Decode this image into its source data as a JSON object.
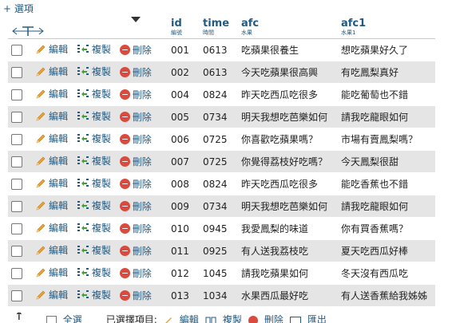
{
  "options_link": "+ 選項",
  "columns": {
    "id": {
      "label": "id",
      "comment": "編號"
    },
    "time": {
      "label": "time",
      "comment": "時間"
    },
    "afc": {
      "label": "afc",
      "comment": "水果"
    },
    "afc1": {
      "label": "afc1",
      "comment": "水果1"
    }
  },
  "actions": {
    "edit": "編輯",
    "copy": "複製",
    "delete": "刪除"
  },
  "rows": [
    {
      "id": "001",
      "time": "0613",
      "afc": "吃蘋果很養生",
      "afc1": "想吃蘋果好久了"
    },
    {
      "id": "002",
      "time": "0613",
      "afc": "今天吃蘋果很高興",
      "afc1": "有吃鳳梨真好"
    },
    {
      "id": "004",
      "time": "0824",
      "afc": "昨天吃西瓜吃很多",
      "afc1": "能吃葡萄也不錯"
    },
    {
      "id": "005",
      "time": "0734",
      "afc": "明天我想吃芭樂如何",
      "afc1": "請我吃龍眼如何"
    },
    {
      "id": "006",
      "time": "0725",
      "afc": "你喜歡吃蘋果嗎？",
      "afc1": "市場有賣鳳梨嗎？"
    },
    {
      "id": "007",
      "time": "0725",
      "afc": "你覺得荔枝好吃嗎？",
      "afc1": "今天鳳梨很甜"
    },
    {
      "id": "008",
      "time": "0824",
      "afc": "昨天吃西瓜吃很多",
      "afc1": "能吃香蕉也不錯"
    },
    {
      "id": "009",
      "time": "0734",
      "afc": "明天我想吃芭樂如何",
      "afc1": "請我吃龍眼如何"
    },
    {
      "id": "010",
      "time": "0945",
      "afc": "我愛鳳梨的味道",
      "afc1": "你有買香蕉嗎？"
    },
    {
      "id": "011",
      "time": "0925",
      "afc": "有人送我荔枝吃",
      "afc1": "夏天吃西瓜好棒"
    },
    {
      "id": "012",
      "time": "1045",
      "afc": "請我吃蘋果如何",
      "afc1": "冬天沒有西瓜吃"
    },
    {
      "id": "013",
      "time": "1034",
      "afc": "水果西瓜最好吃",
      "afc1": "有人送香蕉給我姊姊"
    }
  ],
  "bottom": {
    "select_all": "全選",
    "with_selected": "已選擇項目:",
    "edit": "編輯",
    "copy": "複製",
    "delete": "刪除",
    "export": "匯出"
  },
  "colors": {
    "link": "#235a81",
    "row_alt": "#e5e5e5",
    "delete_icon": "#d84b3e",
    "pencil": "#e8a33a"
  }
}
